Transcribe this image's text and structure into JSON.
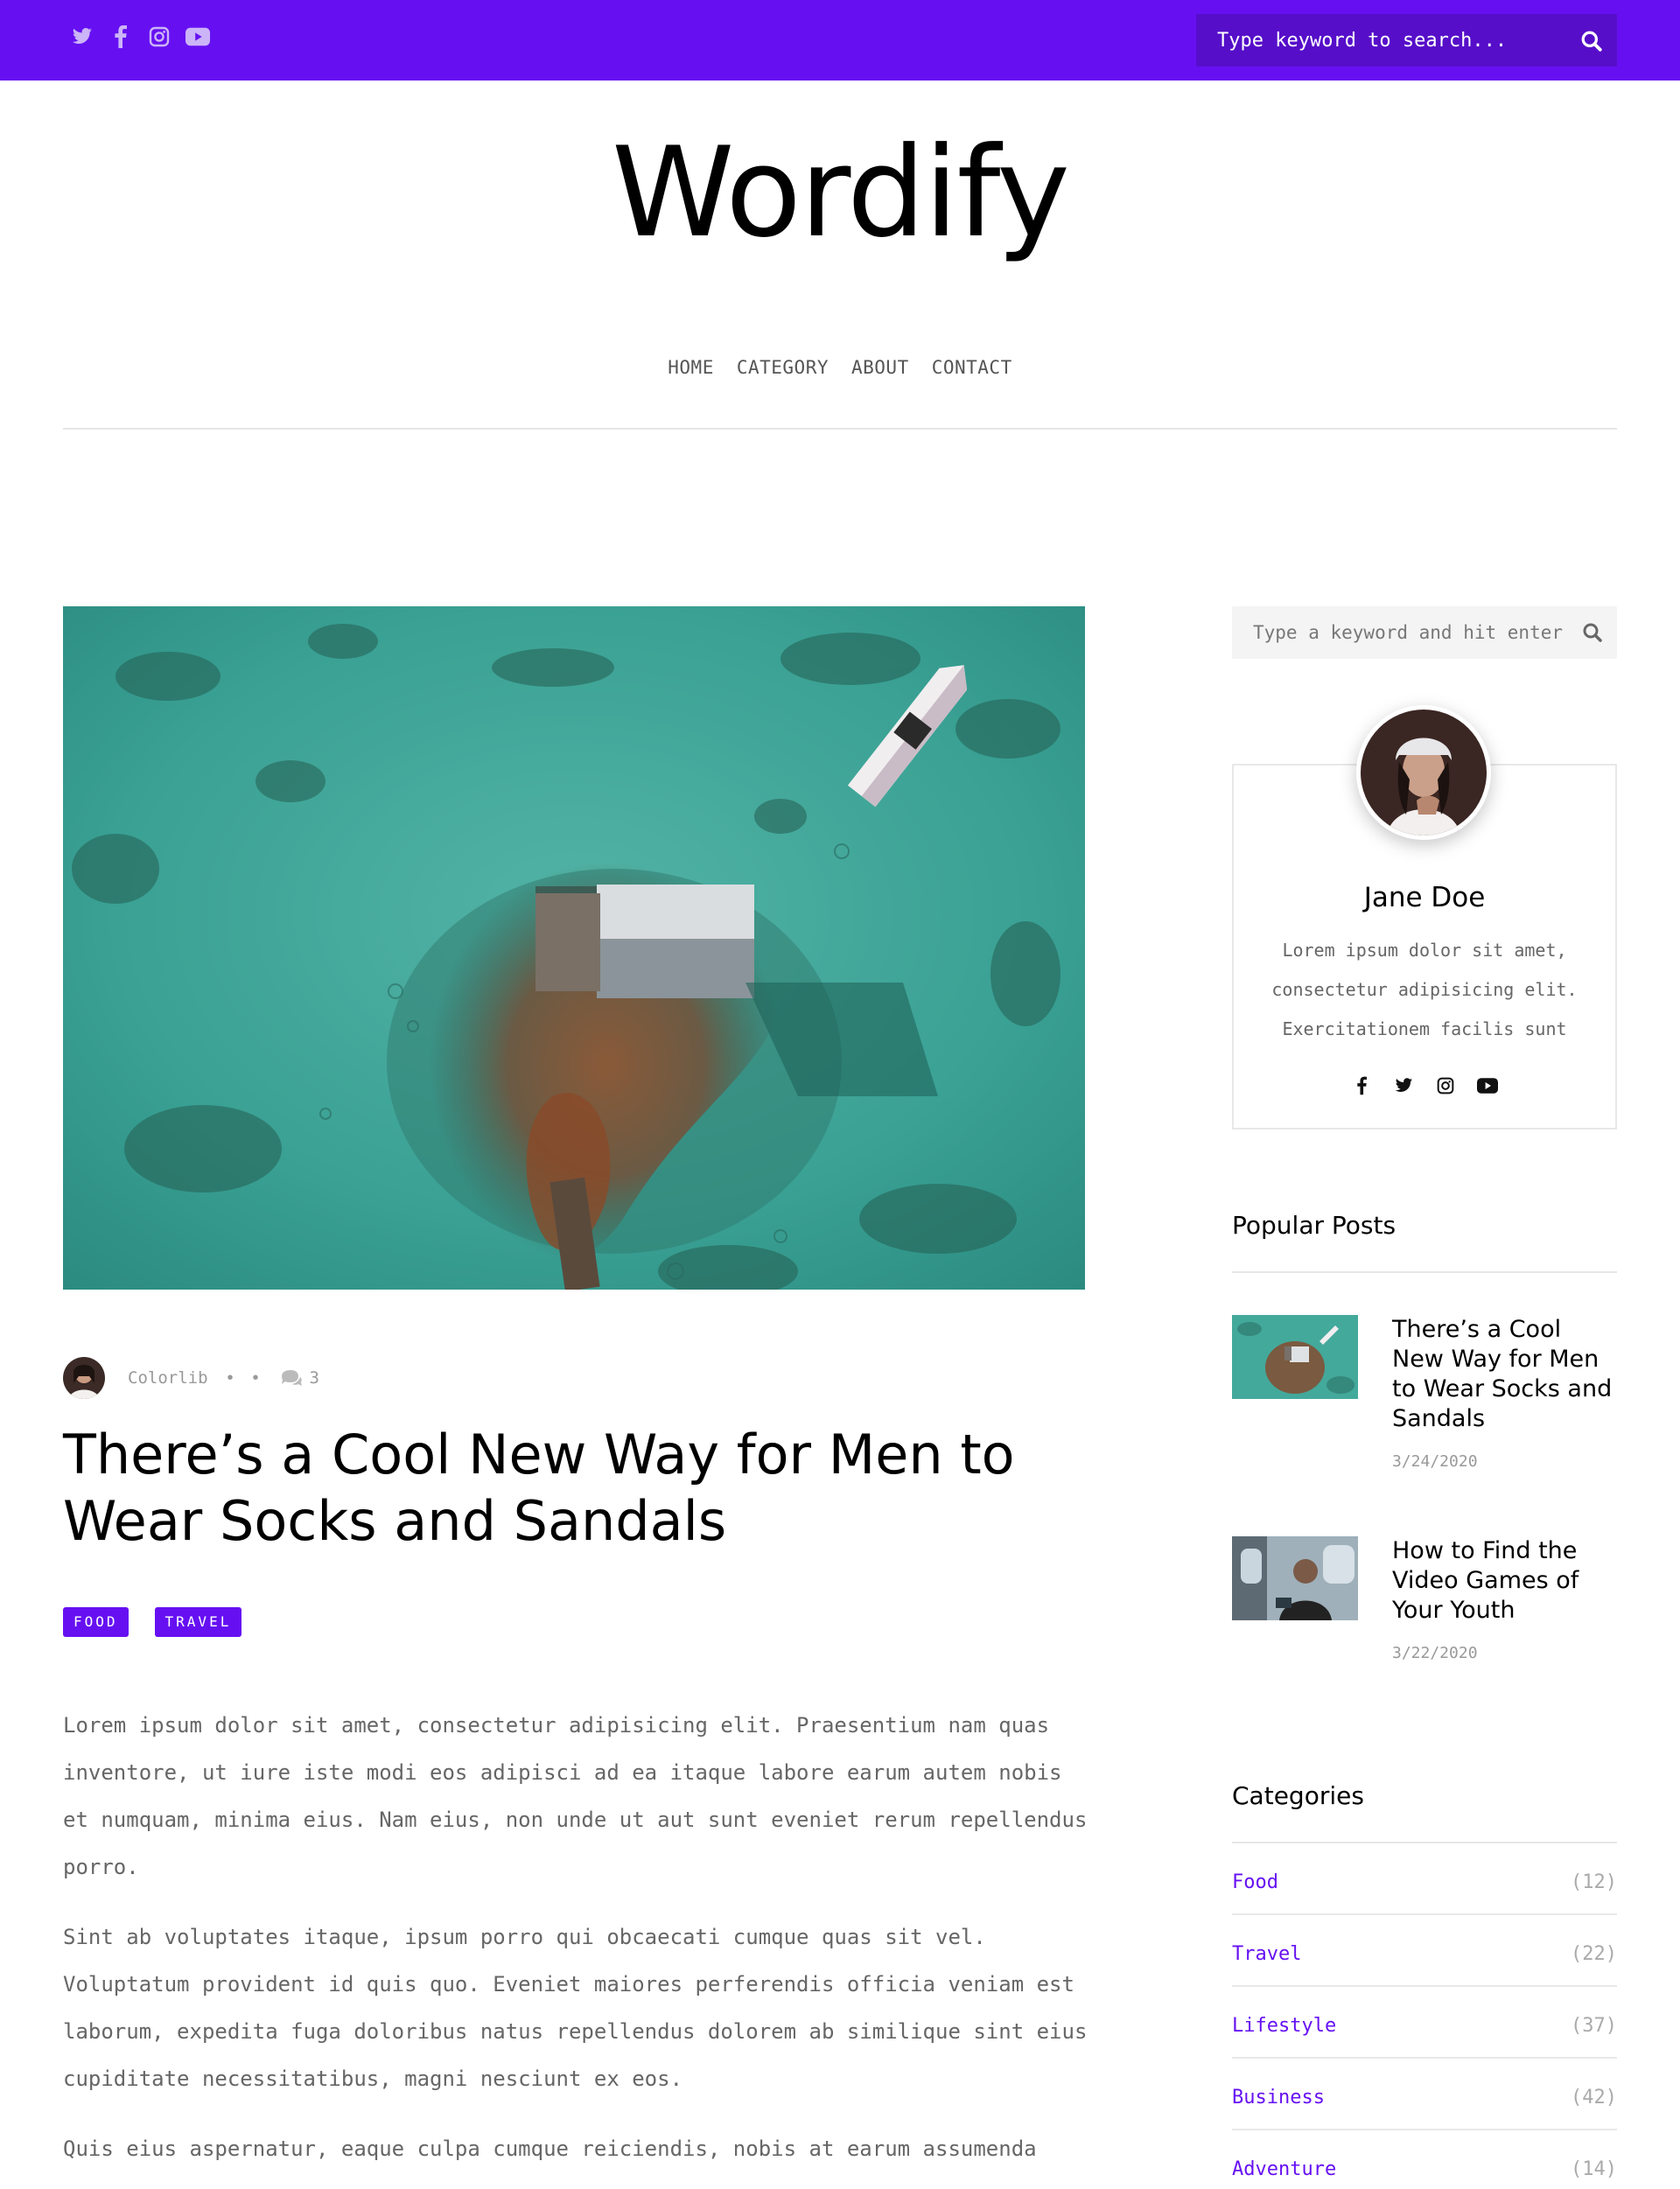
{
  "header": {
    "social": [
      "twitter-icon",
      "facebook-icon",
      "instagram-icon",
      "youtube-icon"
    ],
    "search_placeholder": "Type keyword to search...",
    "accent_color": "#6610f2"
  },
  "logo": "Wordify",
  "nav": {
    "items": [
      {
        "label": "HOME"
      },
      {
        "label": "CATEGORY"
      },
      {
        "label": "ABOUT"
      },
      {
        "label": "CONTACT"
      }
    ]
  },
  "post": {
    "author": "Colorlib",
    "meta_sep1": "•",
    "meta_sep2": "•",
    "comments": "3",
    "title": "There’s a Cool New Way for Men to Wear Socks and Sandals",
    "tags": [
      {
        "label": "FOOD"
      },
      {
        "label": "TRAVEL"
      }
    ],
    "paragraphs": [
      "Lorem ipsum dolor sit amet, consectetur adipisicing elit. Praesentium nam quas inventore, ut iure iste modi eos adipisci ad ea itaque labore earum autem nobis et numquam, minima eius. Nam eius, non unde ut aut sunt eveniet rerum repellendus porro.",
      "Sint ab voluptates itaque, ipsum porro qui obcaecati cumque quas sit vel. Voluptatum provident id quis quo. Eveniet maiores perferendis officia veniam est laborum, expedita fuga doloribus natus repellendus dolorem ab similique sint eius cupiditate necessitatibus, magni nesciunt ex eos.",
      "Quis eius aspernatur, eaque culpa cumque reiciendis, nobis at earum assumenda"
    ]
  },
  "sidebar": {
    "search_placeholder": "Type a keyword and hit enter",
    "bio": {
      "name": "Jane Doe",
      "text": "Lorem ipsum dolor sit amet, consectetur adipisicing elit. Exercitationem facilis sunt",
      "social": [
        "facebook-icon",
        "twitter-icon",
        "instagram-icon",
        "youtube-icon"
      ]
    },
    "popular": {
      "title": "Popular Posts",
      "items": [
        {
          "title": "There’s a Cool New Way for Men to Wear Socks and Sandals",
          "date": "3/24/2020"
        },
        {
          "title": "How to Find the Video Games of Your Youth",
          "date": "3/22/2020"
        }
      ]
    },
    "categories": {
      "title": "Categories",
      "items": [
        {
          "label": "Food",
          "count": "(12)"
        },
        {
          "label": "Travel",
          "count": "(22)"
        },
        {
          "label": "Lifestyle",
          "count": "(37)"
        },
        {
          "label": "Business",
          "count": "(42)"
        },
        {
          "label": "Adventure",
          "count": "(14)"
        }
      ]
    }
  }
}
